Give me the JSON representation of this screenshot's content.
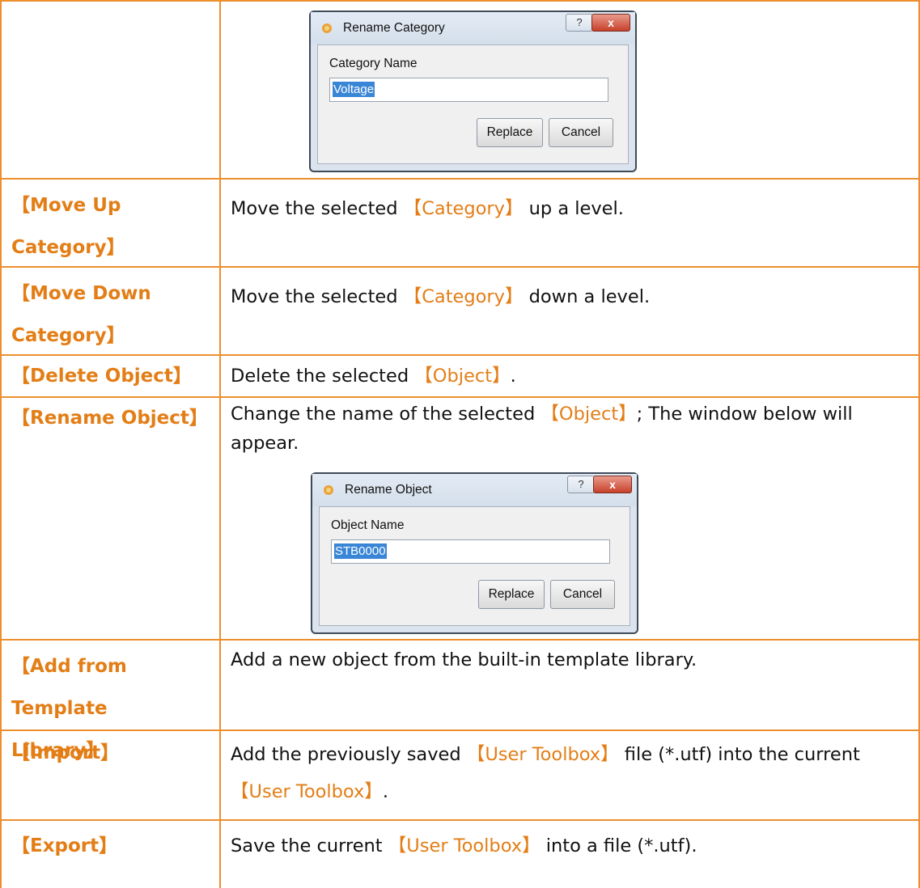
{
  "colors": {
    "accent": "#e37e17",
    "border": "#ee8f2e"
  },
  "dialogs": {
    "rename_category": {
      "title": "Rename Category",
      "label": "Category Name",
      "value": "Voltage",
      "replace": "Replace",
      "cancel": "Cancel",
      "help": "?",
      "close": "x"
    },
    "rename_object": {
      "title": "Rename Object",
      "label": "Object Name",
      "value": "STB0000",
      "replace": "Replace",
      "cancel": "Cancel",
      "help": "?",
      "close": "x"
    }
  },
  "rows": [
    {
      "term": "【Move Up\nCategory】",
      "desc_pre": "Move the selected ",
      "desc_hl": "【Category】",
      "desc_post": " up a level."
    },
    {
      "term": "【Move Down\nCategory】",
      "desc_pre": "Move the selected ",
      "desc_hl": "【Category】",
      "desc_post": " down a level."
    },
    {
      "term": "【Delete Object】",
      "desc_pre": "Delete the selected ",
      "desc_hl": "【Object】",
      "desc_post": "."
    },
    {
      "term": "【Rename Object】",
      "desc_pre": "Change the name of the selected ",
      "desc_hl": "【Object】",
      "desc_post": "; The window below will appear."
    },
    {
      "term": "【Add from Template\nLibrary】",
      "desc_pre": "Add a new object from the built-in template library.",
      "desc_hl": "",
      "desc_post": ""
    },
    {
      "term": "【Import】",
      "desc_pre": "Add the previously saved ",
      "desc_hl": "【User Toolbox】",
      "desc_post": " file (*.utf) into the current ",
      "desc_hl2": "【User Toolbox】",
      "desc_post2": "."
    },
    {
      "term": "【Export】",
      "desc_pre": "Save the current ",
      "desc_hl": "【User Toolbox】",
      "desc_post": " into a file (*.utf)."
    }
  ]
}
